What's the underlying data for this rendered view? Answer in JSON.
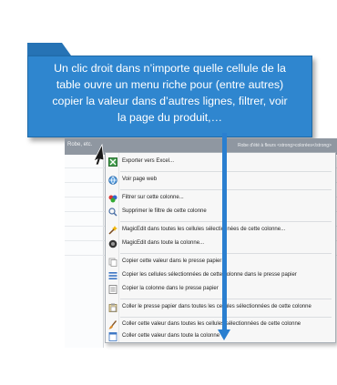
{
  "callout": {
    "text": "Un clic droit dans n’importe quelle cellule de la\ntable ouvre un menu riche pour (entre autres)\ncopier la valeur dans d’autres lignes, filtrer, voir\nla page du produit,…"
  },
  "grid": {
    "header_left": "Robe, etc.",
    "header_right": "Robe d'été à fleurs <strong>colorées</strong>"
  },
  "menu": {
    "items": [
      {
        "label": "Exporter vers Excel...",
        "icon": "excel-icon"
      },
      {
        "label": "Voir page web",
        "icon": "globe-icon"
      },
      {
        "label": "Filtrer sur cette colonne...",
        "icon": "filter-icon"
      },
      {
        "label": "Supprimer le filtre de  cette colonne",
        "icon": "remove-filter-icon"
      },
      {
        "label": "MagicEdit dans toutes les cellules sélectionnées de cette colonne...",
        "icon": "magic-wand-icon"
      },
      {
        "label": "MagicEdit dans toute la colonne...",
        "icon": "magic-circle-icon"
      },
      {
        "label": "Copier cette valeur dans le presse papier",
        "icon": "copy-icon"
      },
      {
        "label": "Copier les cellules sélectionnées de cette colonne dans le presse papier",
        "icon": "copy-list-icon"
      },
      {
        "label": "Copier la colonne dans le presse papier",
        "icon": "copy-column-icon"
      },
      {
        "label": "Coller le presse papier dans toutes les cellules sélectionnées de cette colonne",
        "icon": "paste-icon"
      },
      {
        "label": "Coller cette valeur dans toutes les cellules sélectionnées de cette colonne",
        "icon": "brush-icon"
      },
      {
        "label": "Coller cette valeur dans toute la colonne",
        "icon": "paste-column-icon"
      }
    ]
  },
  "colors": {
    "callout_bg": "#2f86cf",
    "arrow": "#2a7fd0",
    "header_bg": "#8f97a1"
  }
}
